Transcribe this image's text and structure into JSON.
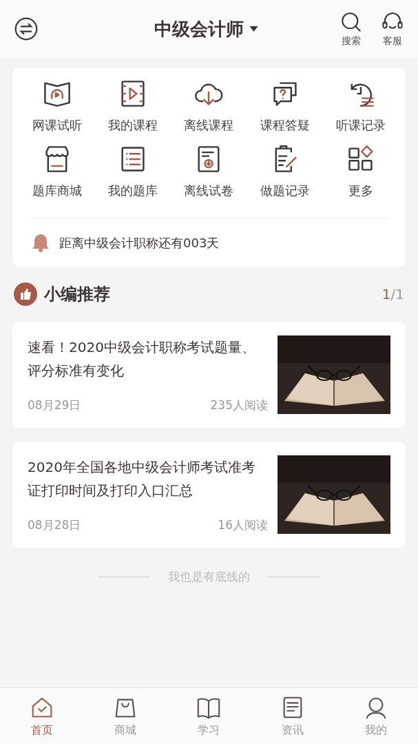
{
  "header": {
    "title": "中级会计师",
    "actions": [
      {
        "label": "搜索"
      },
      {
        "label": "客服"
      }
    ]
  },
  "grid": [
    {
      "label": "网课试听"
    },
    {
      "label": "我的课程"
    },
    {
      "label": "离线课程"
    },
    {
      "label": "课程答疑"
    },
    {
      "label": "听课记录"
    },
    {
      "label": "题库商城"
    },
    {
      "label": "我的题库"
    },
    {
      "label": "离线试卷"
    },
    {
      "label": "做题记录"
    },
    {
      "label": "更多"
    }
  ],
  "countdown": "距离中级会计职称还有003天",
  "section": {
    "title": "小编推荐",
    "page_current": "1",
    "page_total": "/1"
  },
  "articles": [
    {
      "title": "速看！2020中级会计职称考试题量、评分标准有变化",
      "date": "08月29日",
      "reads": "235人阅读"
    },
    {
      "title": "2020年全国各地中级会计师考试准考证打印时间及打印入口汇总",
      "date": "08月28日",
      "reads": "16人阅读"
    }
  ],
  "end_note": "我也是有底线的",
  "tabbar": [
    {
      "label": "首页",
      "selected": true
    },
    {
      "label": "商城",
      "selected": false
    },
    {
      "label": "学习",
      "selected": false
    },
    {
      "label": "资讯",
      "selected": false
    },
    {
      "label": "我的",
      "selected": false
    }
  ]
}
